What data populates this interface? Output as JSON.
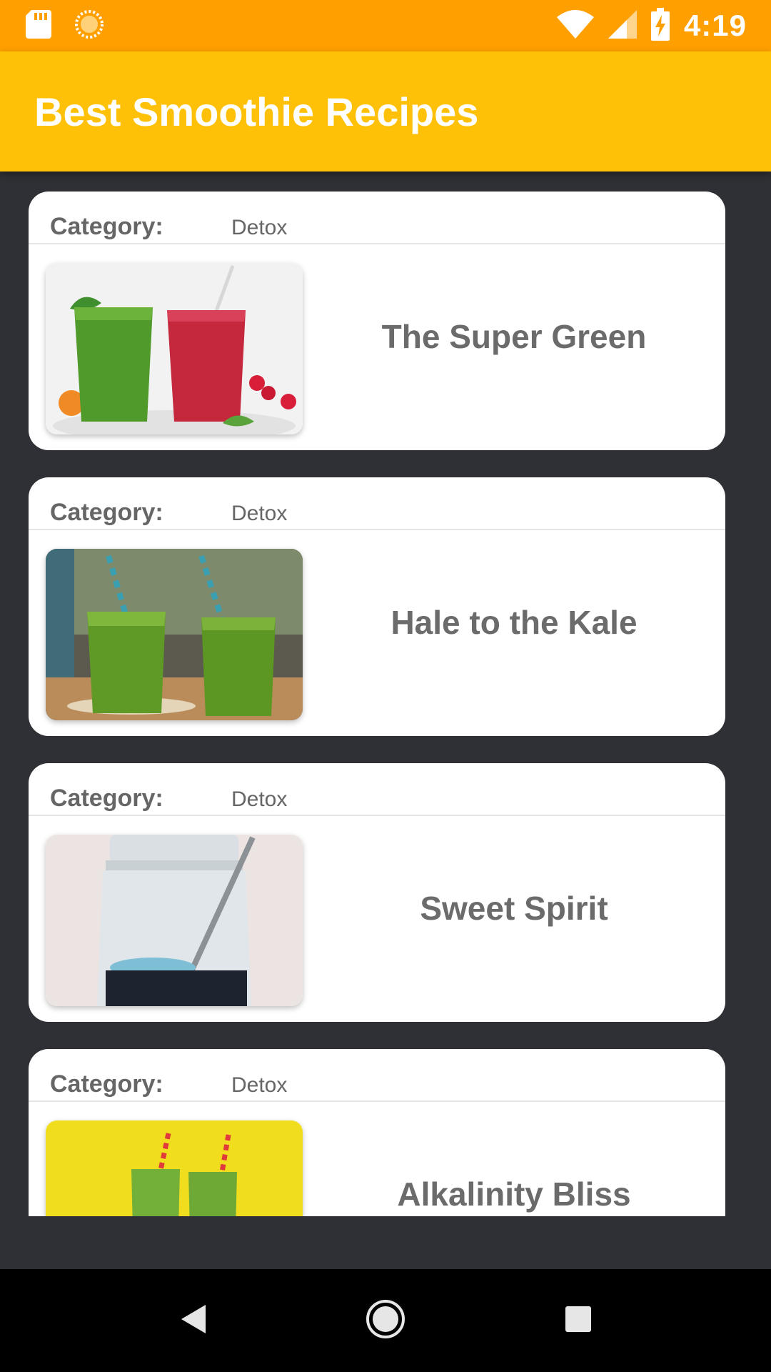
{
  "status_bar": {
    "time": "4:19",
    "icons": [
      "sd-card-icon",
      "sync-icon",
      "wifi-icon",
      "signal-icon",
      "battery-charging-icon"
    ]
  },
  "app_bar": {
    "title": "Best Smoothie Recipes",
    "color": "#FFC107"
  },
  "recipes": [
    {
      "category_label": "Category:",
      "category": "Detox",
      "name": "The Super Green",
      "image": "green-and-red-smoothies-image"
    },
    {
      "category_label": "Category:",
      "category": "Detox",
      "name": "Hale to the Kale",
      "image": "two-green-smoothies-with-straws-image"
    },
    {
      "category_label": "Category:",
      "category": "Detox",
      "name": "Sweet Spirit",
      "image": "glass-jar-with-spoon-image"
    },
    {
      "category_label": "Category:",
      "category": "Detox",
      "name": "Alkalinity Bliss",
      "image": "green-smoothies-yellow-background-image"
    }
  ],
  "nav_bar": {
    "buttons": [
      "back-icon",
      "home-icon",
      "recents-icon"
    ]
  },
  "colors": {
    "status_bar": "#FFA000",
    "app_bar": "#FFC107",
    "background": "#2f3035",
    "card": "#ffffff",
    "text": "#6b6b6b"
  }
}
